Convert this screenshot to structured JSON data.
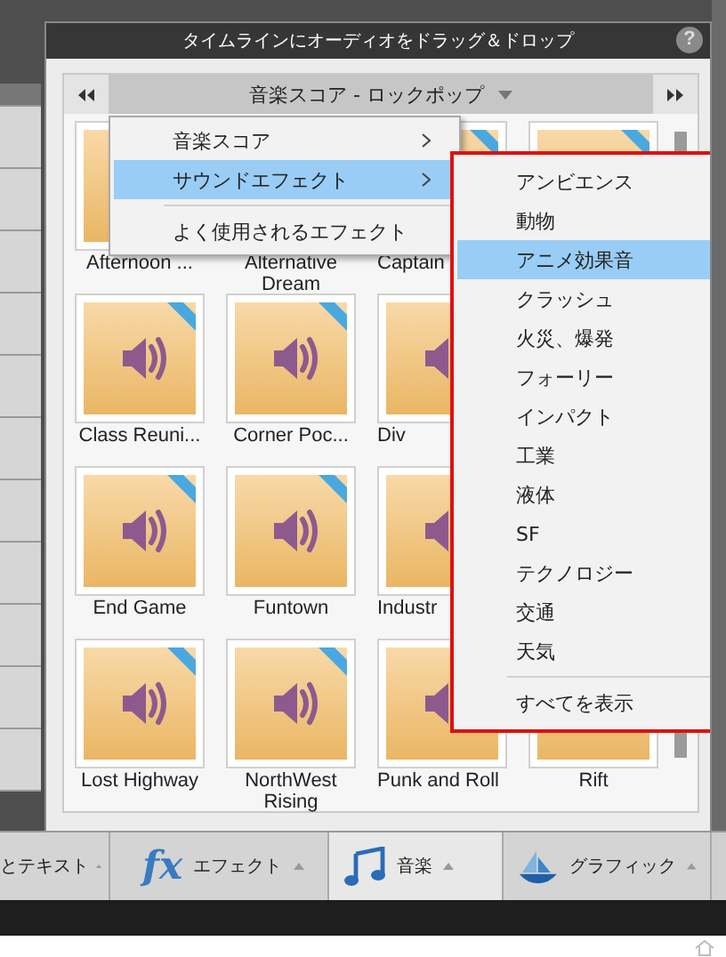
{
  "window": {
    "title": "タイムラインにオーディオをドラッグ＆ドロップ",
    "help": "?"
  },
  "navigator": {
    "category": "音楽スコア - ロックポップ"
  },
  "tile_rows": [
    {
      "tiles": [
        {
          "kind": "audio",
          "label": "Afternoon ..."
        },
        {
          "label": "Alternative Dream"
        },
        {
          "kind": "audio",
          "label": "Captain"
        },
        {
          "kind": "audio"
        }
      ]
    },
    {
      "tiles": [
        {
          "kind": "audio",
          "label": "Class Reuni..."
        },
        {
          "kind": "audio",
          "label": "Corner Poc..."
        },
        {
          "kind": "audio",
          "label": "Div"
        }
      ]
    },
    {
      "tiles": [
        {
          "kind": "audio",
          "label": "End Game"
        },
        {
          "kind": "audio",
          "label": "Funtown"
        },
        {
          "kind": "audio",
          "label": "Industr"
        }
      ]
    },
    {
      "tiles": [
        {
          "kind": "audio",
          "label": "Lost Highway"
        },
        {
          "kind": "audio",
          "label": "NorthWest Rising"
        },
        {
          "kind": "audio",
          "label": "Punk and Roll"
        },
        {
          "kind": "audio",
          "label": "Rift"
        }
      ]
    }
  ],
  "context_menu": {
    "items": [
      {
        "label": "音楽スコア",
        "submenu": true,
        "selected": false
      },
      {
        "label": "サウンドエフェクト",
        "submenu": true,
        "selected": true
      },
      {
        "kind": "separator"
      },
      {
        "label": "よく使用されるエフェクト",
        "submenu": false,
        "selected": false
      }
    ]
  },
  "submenu": {
    "items": [
      {
        "label": "アンビエンス",
        "selected": false
      },
      {
        "label": "動物",
        "selected": false
      },
      {
        "label": "アニメ効果音",
        "selected": true
      },
      {
        "label": "クラッシュ",
        "selected": false
      },
      {
        "label": "火災、爆発",
        "selected": false
      },
      {
        "label": "フォーリー",
        "selected": false
      },
      {
        "label": "インパクト",
        "selected": false
      },
      {
        "label": "工業",
        "selected": false
      },
      {
        "label": "液体",
        "selected": false
      },
      {
        "label": "SF",
        "selected": false
      },
      {
        "label": "テクノロジー",
        "selected": false
      },
      {
        "label": "交通",
        "selected": false
      },
      {
        "label": "天気",
        "selected": false
      },
      {
        "kind": "separator"
      },
      {
        "label": "すべてを表示",
        "selected": false
      }
    ]
  },
  "bottom_tabs": [
    {
      "kind": "text",
      "label": "とテキスト",
      "selected": false
    },
    {
      "kind": "effects",
      "icon_text": "fx",
      "label": "エフェクト",
      "selected": false
    },
    {
      "kind": "music",
      "label": "音楽",
      "selected": true
    },
    {
      "kind": "graphics",
      "label": "グラフィック",
      "selected": false
    }
  ]
}
